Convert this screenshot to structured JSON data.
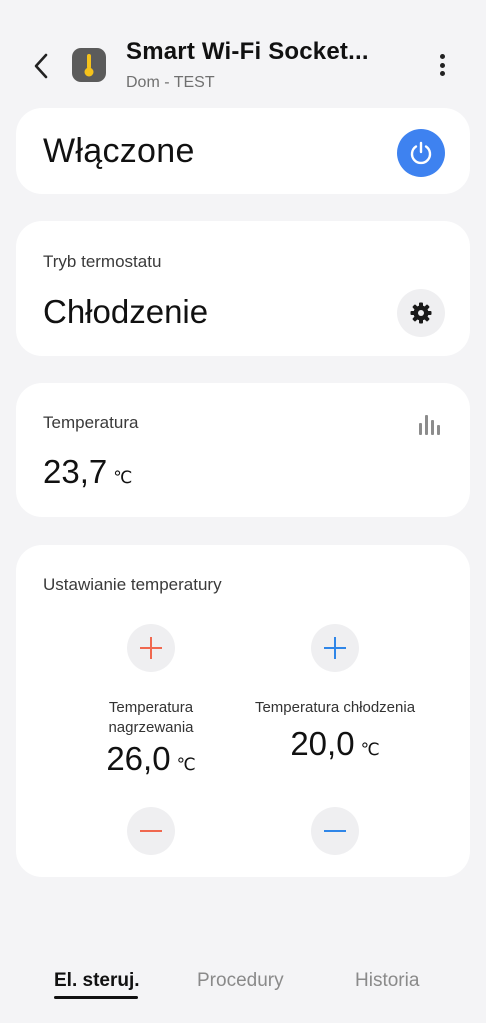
{
  "header": {
    "title": "Smart Wi-Fi Socket...",
    "subtitle": "Dom - TEST",
    "back_icon": "chevron-left-icon",
    "device_icon": "thermometer-icon",
    "menu_icon": "more-vertical-icon"
  },
  "power": {
    "status_label": "Włączone",
    "icon": "power-icon",
    "accent_color": "#3e82f0"
  },
  "thermostat_mode": {
    "caption": "Tryb termostatu",
    "value": "Chłodzenie",
    "icon": "gear-icon"
  },
  "temperature": {
    "caption": "Temperatura",
    "value": "23,7",
    "unit": "℃",
    "icon": "bar-chart-icon"
  },
  "setpoints": {
    "caption": "Ustawianie temperatury",
    "heating": {
      "label": "Temperatura nagrzewania",
      "value": "26,0",
      "unit": "℃",
      "color": "#f0684f"
    },
    "cooling": {
      "label": "Temperatura chłodzenia",
      "value": "20,0",
      "unit": "℃",
      "color": "#2f86e8"
    }
  },
  "bottom_nav": {
    "tabs": [
      {
        "label": "El. steruj.",
        "active": true
      },
      {
        "label": "Procedury",
        "active": false
      },
      {
        "label": "Historia",
        "active": false
      }
    ]
  }
}
